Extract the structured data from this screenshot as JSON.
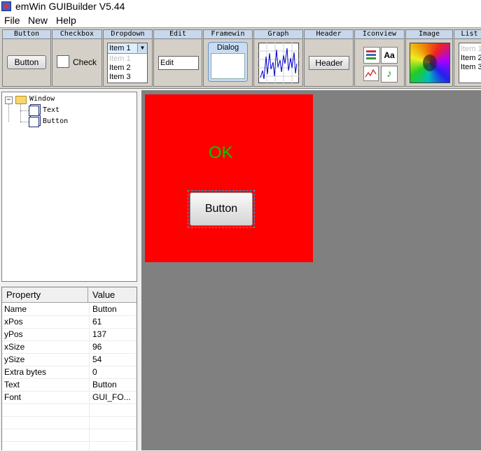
{
  "window": {
    "title": "emWin GUIBuilder V5.44"
  },
  "menu": {
    "items": [
      "File",
      "New",
      "Help"
    ]
  },
  "toolbar": {
    "button": {
      "label": "Button",
      "preview": "Button"
    },
    "checkbox": {
      "label": "Checkbox",
      "preview": "Check"
    },
    "dropdown": {
      "label": "Dropdown",
      "selected": "Item 1",
      "items": [
        "Item 1",
        "Item 2",
        "Item 3"
      ]
    },
    "edit": {
      "label": "Edit",
      "preview": "Edit"
    },
    "framewin": {
      "label": "Framewin",
      "preview": "Dialog"
    },
    "graph": {
      "label": "Graph"
    },
    "header": {
      "label": "Header",
      "preview": "Header"
    },
    "iconview": {
      "label": "Iconview"
    },
    "image": {
      "label": "Image"
    },
    "listbox": {
      "label": "List",
      "items": [
        "Item 1",
        "Item 2",
        "Item 3"
      ]
    }
  },
  "tree": {
    "root": "Window",
    "children": [
      "Text",
      "Button"
    ]
  },
  "properties": {
    "col_property": "Property",
    "col_value": "Value",
    "rows": [
      {
        "name": "Name",
        "value": "Button"
      },
      {
        "name": "xPos",
        "value": "61"
      },
      {
        "name": "yPos",
        "value": "137"
      },
      {
        "name": "xSize",
        "value": "96"
      },
      {
        "name": "ySize",
        "value": "54"
      },
      {
        "name": "Extra bytes",
        "value": "0"
      },
      {
        "name": "Text",
        "value": "Button"
      },
      {
        "name": "Font",
        "value": "GUI_FO..."
      }
    ]
  },
  "design": {
    "text": "OK",
    "text_color": "#00cc00",
    "window_color": "#ff0000",
    "button_text": "Button"
  }
}
